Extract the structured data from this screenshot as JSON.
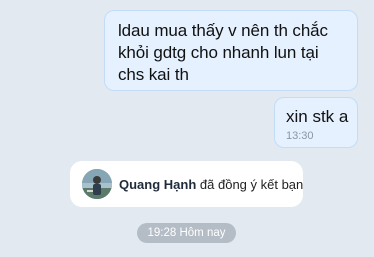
{
  "messages": [
    {
      "text": "ldau mua thấy v nên th chắc khỏi gdtg cho nhanh lun tại chs kai th"
    },
    {
      "text": "xin stk a",
      "time": "13:30"
    }
  ],
  "friend_notice": {
    "name": "Quang Hạnh",
    "text": "đã đồng ý kết bạn",
    "avatar_icon": "user-avatar-photo"
  },
  "date_separator": "19:28 Hôm nay",
  "colors": {
    "chat_background": "#e2e9f1",
    "outgoing_bubble": "#e5f1ff",
    "outgoing_border": "#c3dcf6",
    "time_pill": "#b4bcc5"
  }
}
